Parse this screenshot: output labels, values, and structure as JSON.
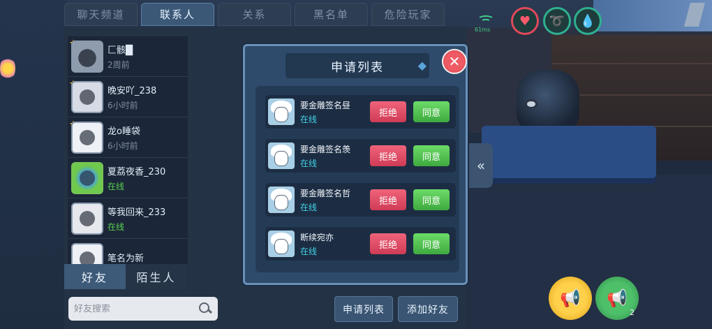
{
  "top_tabs": [
    "聊天频道",
    "联系人",
    "关系",
    "黑名单",
    "危险玩家"
  ],
  "friends": [
    {
      "name": "匚骸█",
      "status": "2周前",
      "online": false,
      "starred": true
    },
    {
      "name": "晚安吖_238",
      "status": "6小时前",
      "online": false,
      "starred": true
    },
    {
      "name": "龙o睡袋",
      "status": "6小时前",
      "online": false,
      "starred": true
    },
    {
      "name": "夏荔夜香_230",
      "status": "在线",
      "online": true,
      "starred": false
    },
    {
      "name": "等我回来_233",
      "status": "在线",
      "online": true,
      "starred": false
    },
    {
      "name": "笔名为新",
      "status": "",
      "online": false,
      "starred": false
    }
  ],
  "sub_tabs": {
    "friends": "好友",
    "strangers": "陌生人"
  },
  "search": {
    "placeholder": "好友搜索"
  },
  "bottom_buttons": {
    "apply_list": "申请列表",
    "add_friend": "添加好友"
  },
  "hud": {
    "ping": "61ms",
    "sound_count": "2"
  },
  "modal": {
    "title": "申请列表",
    "reject_label": "拒绝",
    "accept_label": "同意",
    "requests": [
      {
        "name": "要金雕签名昼",
        "status": "在线"
      },
      {
        "name": "要金雕签名羡",
        "status": "在线"
      },
      {
        "name": "要金雕签名哲",
        "status": "在线"
      },
      {
        "name": "断续宛亦",
        "status": "在线"
      }
    ]
  }
}
